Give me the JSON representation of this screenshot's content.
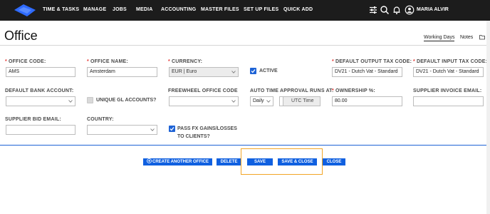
{
  "nav": {
    "items": [
      "TIME & TASKS",
      "MANAGE",
      "JOBS",
      "MEDIA",
      "ACCOUNTING",
      "MASTER FILES",
      "SET UP FILES",
      "QUICK ADD"
    ],
    "user_name": "MARIA ALVIR",
    "icons": [
      "sliders-icon",
      "search-icon",
      "bell-icon",
      "user-icon"
    ]
  },
  "page": {
    "title": "Office",
    "tabs": {
      "working_days": "Working Days",
      "notes": "Notes"
    }
  },
  "form": {
    "office_code": {
      "label": "OFFICE CODE:",
      "value": "AMS",
      "required": true
    },
    "office_name": {
      "label": "OFFICE NAME:",
      "value": "Amsterdam",
      "required": true
    },
    "currency": {
      "label": "CURRENCY:",
      "value": "EUR | Euro",
      "required": true
    },
    "active": {
      "label": "ACTIVE",
      "checked": true
    },
    "default_output_tax": {
      "label": "DEFAULT OUTPUT TAX CODE:",
      "value": "DV21 - Dutch Vat - Standard",
      "required": true
    },
    "default_input_tax": {
      "label": "DEFAULT INPUT TAX CODE:",
      "value": "DV21 - Dutch Vat - Standard",
      "required": true
    },
    "default_bank_account": {
      "label": "DEFAULT BANK ACCOUNT:",
      "value": ""
    },
    "unique_gl": {
      "label": "UNIQUE GL ACCOUNTS?",
      "checked": false
    },
    "freewheel_office_code": {
      "label": "FREEWHEEL OFFICE CODE",
      "value": ""
    },
    "auto_time_approval": {
      "label": "AUTO TIME APPROVAL RUNS AT:",
      "frequency": "Daily",
      "time_placeholder": "UTC Time"
    },
    "ownership": {
      "label": "OWNERSHIP %:",
      "value": "80.00",
      "required": true
    },
    "supplier_invoice_email": {
      "label": "SUPPLIER INVOICE EMAIL:",
      "value": ""
    },
    "supplier_bid_email": {
      "label": "SUPPLIER BID EMAIL:",
      "value": ""
    },
    "country": {
      "label": "COUNTRY:",
      "value": ""
    },
    "pass_fx": {
      "label_line1": "PASS FX GAINS/LOSSES",
      "label_line2": "TO CLIENTS?",
      "checked": true
    }
  },
  "buttons": {
    "create_another": "CREATE ANOTHER OFFICE",
    "delete": "DELETE",
    "save": "SAVE",
    "save_close": "SAVE & CLOSE",
    "close": "CLOSE"
  },
  "colors": {
    "accent": "#1060e0",
    "topbar": "#1c1c1c",
    "highlight": "#f2a526",
    "required": "#e53935"
  }
}
